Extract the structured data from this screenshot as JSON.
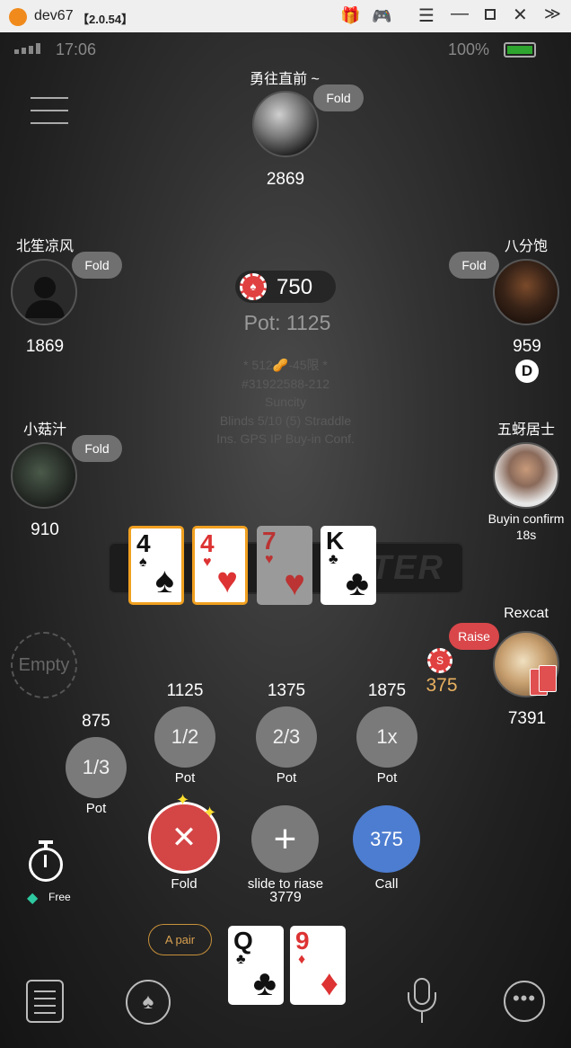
{
  "titlebar": {
    "app": "dev67",
    "version": "【2.0.54】"
  },
  "status": {
    "time": "17:06",
    "battery": "100%"
  },
  "players": {
    "top": {
      "name": "勇往直前 ~",
      "action": "Fold",
      "stack": "2869"
    },
    "left1": {
      "name": "北笙凉风",
      "action": "Fold",
      "stack": "1869"
    },
    "right1": {
      "name": "八分饱",
      "action": "Fold",
      "stack": "959",
      "dealer": "D"
    },
    "left2": {
      "name": "小菇汁",
      "action": "Fold",
      "stack": "910"
    },
    "right2": {
      "name": "五蚜居士",
      "status": "Buyin confirm",
      "timer": "18s"
    },
    "right3": {
      "name": "Rexcat",
      "action": "Raise",
      "bet": "375",
      "stack": "7391"
    },
    "empty": {
      "label": "Empty"
    }
  },
  "pot": {
    "chips": "750",
    "pot": "Pot: 1125"
  },
  "info": [
    "* 512🥜-45限 *",
    "#31922588-212",
    "Suncity",
    "Blinds 5/10 (5) Straddle",
    "Ins. GPS IP Buy-in Conf."
  ],
  "watermark": "STER",
  "board": [
    {
      "rank": "4",
      "suit": "♠",
      "color": "#111",
      "style": "hl"
    },
    {
      "rank": "4",
      "suit": "♥",
      "color": "#d33",
      "style": "hl"
    },
    {
      "rank": "7",
      "suit": "♥",
      "color": "#b33",
      "style": "dim"
    },
    {
      "rank": "K",
      "suit": "♣",
      "color": "#111",
      "style": ""
    }
  ],
  "bets": [
    {
      "amount": "875",
      "label": "1/3",
      "sub": "Pot"
    },
    {
      "amount": "1125",
      "label": "1/2",
      "sub": "Pot"
    },
    {
      "amount": "1375",
      "label": "2/3",
      "sub": "Pot"
    },
    {
      "amount": "1875",
      "label": "1x",
      "sub": "Pot"
    }
  ],
  "actions": {
    "fold": "Fold",
    "raise": "slide to riase",
    "raise_amount": "3779",
    "call_amount": "375",
    "call": "Call"
  },
  "timebank": {
    "label": "Free"
  },
  "hand": {
    "label": "A pair",
    "cards": [
      {
        "rank": "Q",
        "suit": "♣",
        "color": "#111"
      },
      {
        "rank": "9",
        "suit": "♦",
        "color": "#d33"
      }
    ]
  }
}
